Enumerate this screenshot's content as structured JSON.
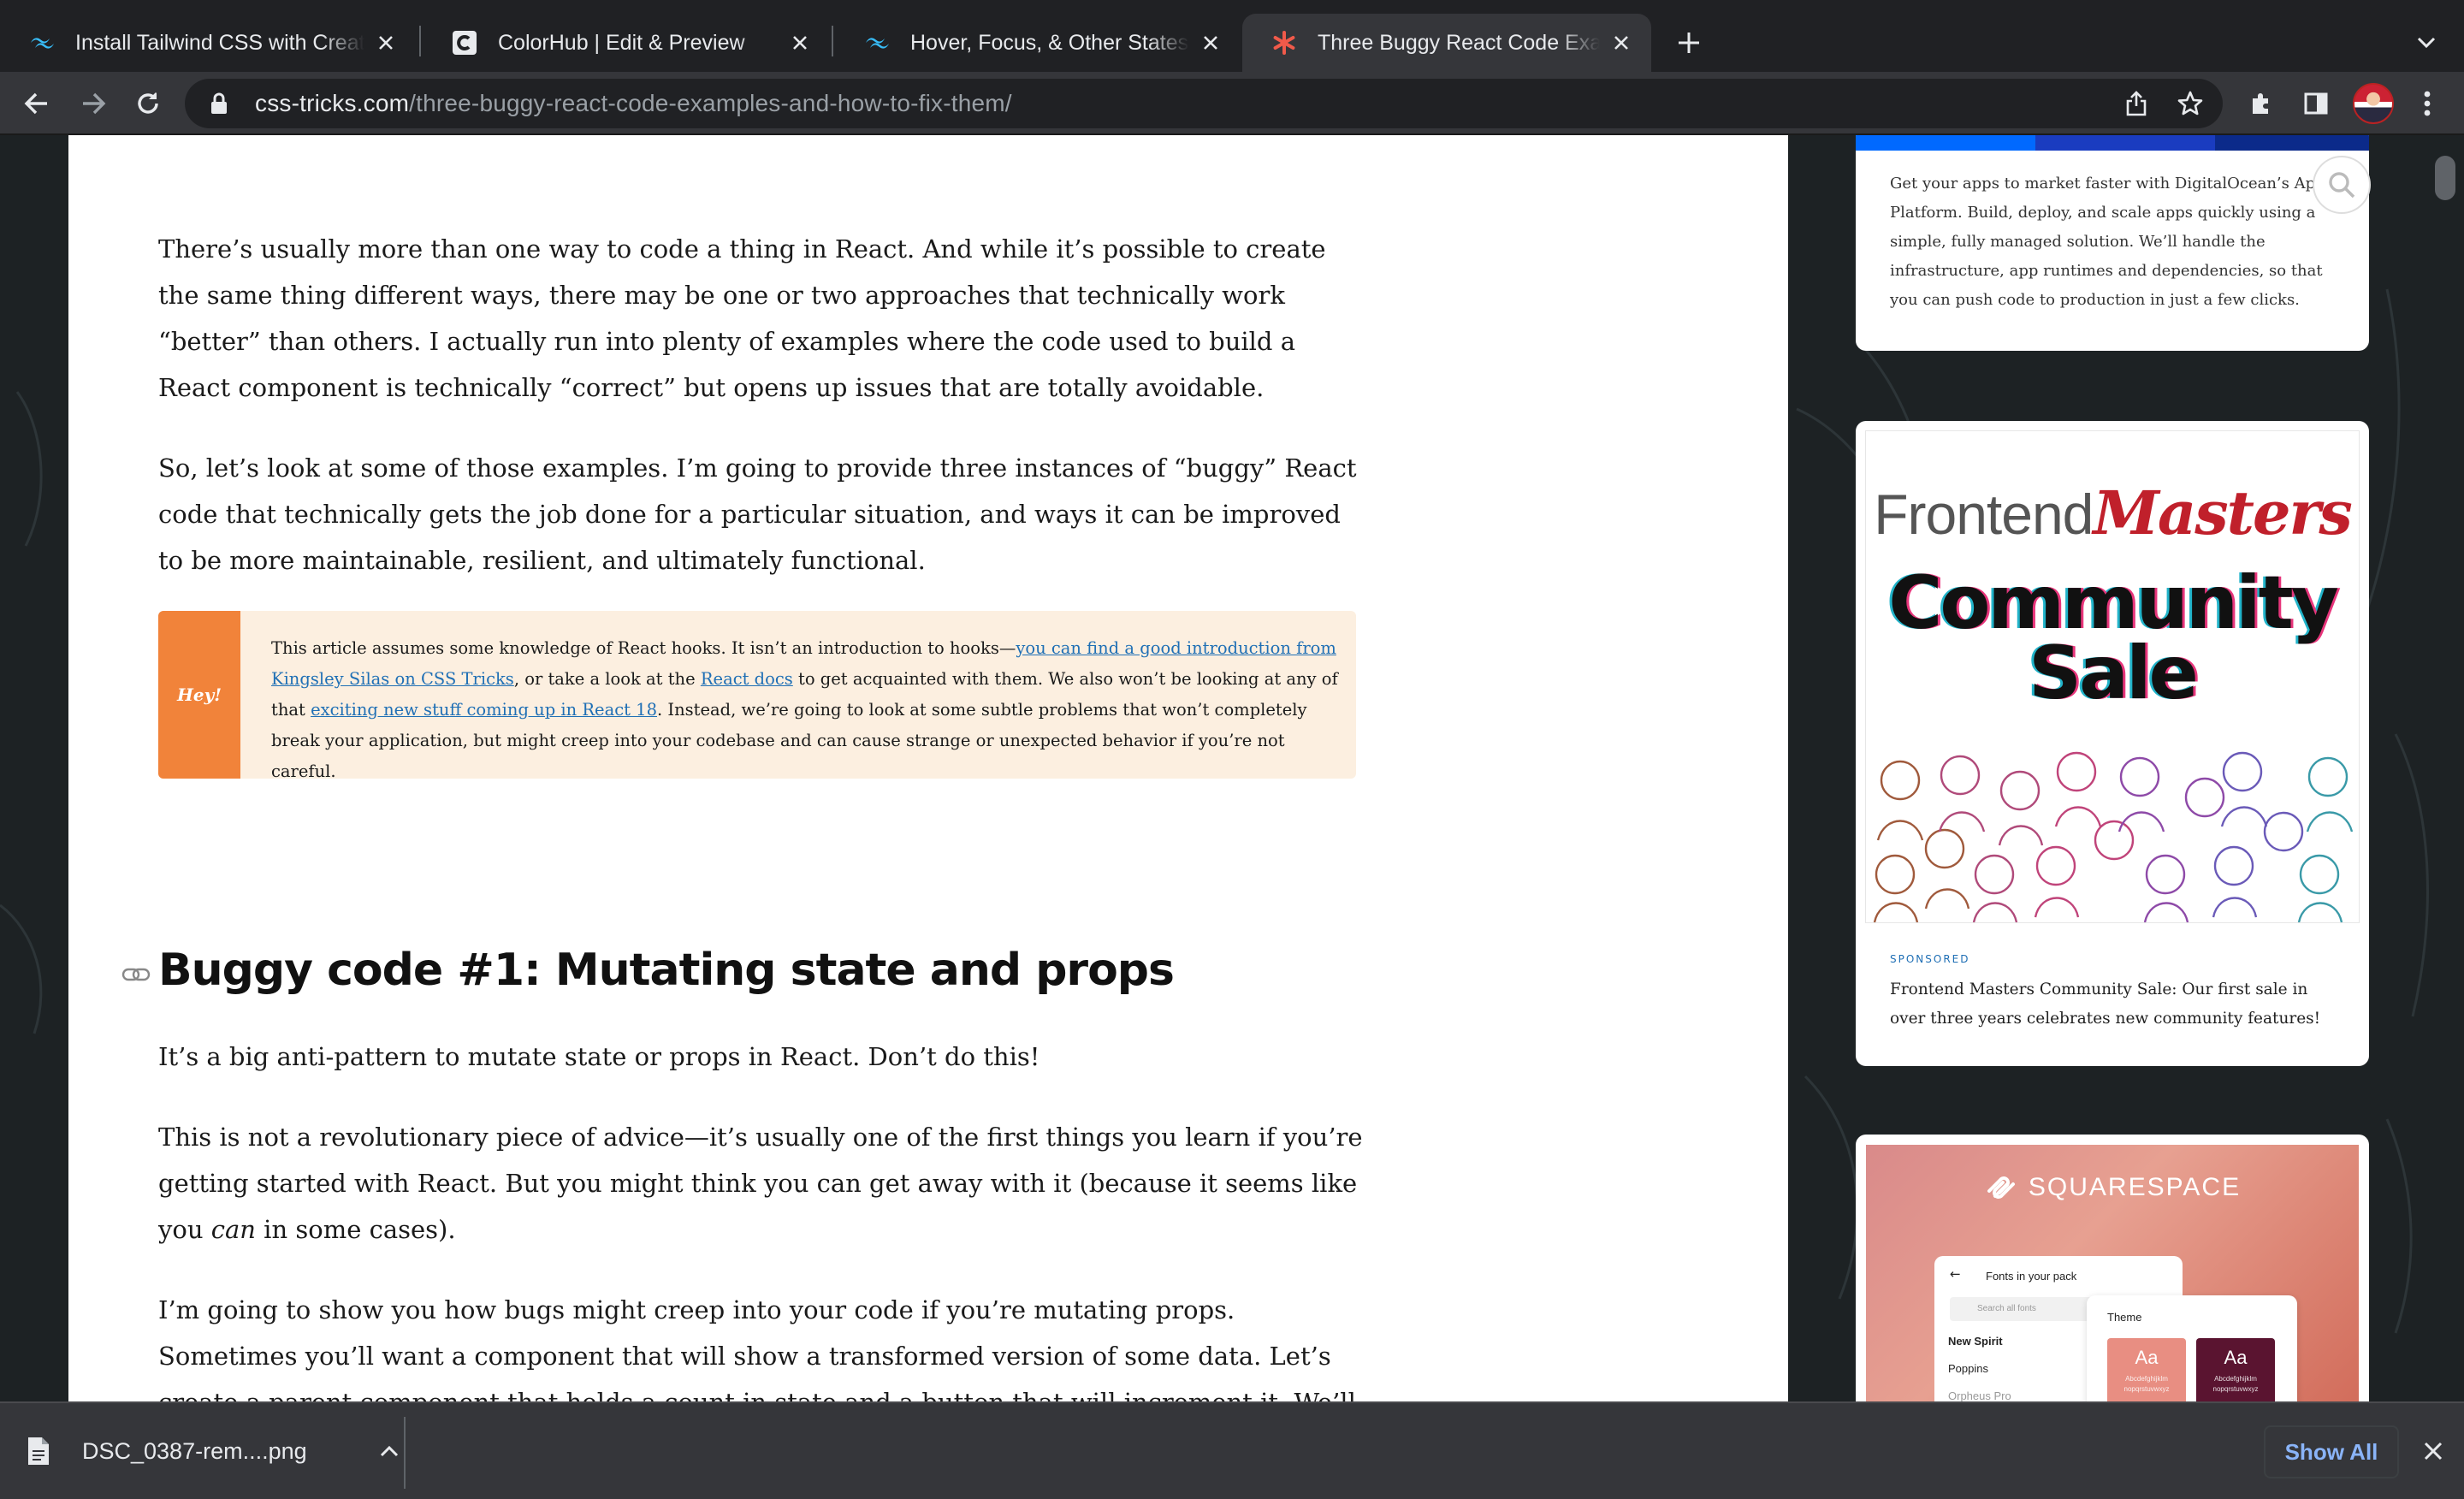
{
  "browser": {
    "tabs": [
      {
        "title": "Install Tailwind CSS with Create React App",
        "favicon": "tailwind-icon"
      },
      {
        "title": "ColorHub | Edit & Preview",
        "favicon": "colorhub-icon"
      },
      {
        "title": "Hover, Focus, & Other States - Tailwind CSS",
        "favicon": "tailwind-icon"
      },
      {
        "title": "Three Buggy React Code Examples",
        "favicon": "css-tricks-star-icon"
      }
    ],
    "active_tab": 3,
    "url_host": "css-tricks.com",
    "url_path": "/three-buggy-react-code-examples-and-how-to-fix-them/"
  },
  "article": {
    "p1": "There’s usually more than one way to code a thing in React. And while it’s possible to create the same thing different ways, there may be one or two approaches that technically work “better” than others. I actually run into plenty of examples where the code used to build a React component is technically “correct” but opens up issues that are totally avoidable.",
    "p2": "So, let’s look at some of those examples. I’m going to provide three instances of “buggy” React code that technically gets the job done for a particular situation, and ways it can be improved to be more maintainable, resilient, and ultimately functional.",
    "callout": {
      "tag": "Hey!",
      "t1": "This article assumes some knowledge of React hooks. It isn’t an introduction to hooks—",
      "link1": "you can find a good introduction from Kingsley Silas on CSS Tricks",
      "t2": ", or take a look at the ",
      "link2": "React docs",
      "t3": " to get acquainted with them. We also won’t be looking at any of that ",
      "link3": "exciting new stuff coming up in React 18",
      "t4": ". Instead, we’re going to look at some subtle problems that won’t completely break your application, but might creep into your codebase and can cause strange or unexpected behavior if you’re not careful."
    },
    "heading": "Buggy code #1: Mutating state and props",
    "p3": "It’s a big anti-pattern to mutate state or props in React. Don’t do this!",
    "p4_a": "This is not a revolutionary piece of advice—it’s usually one of the first things you learn if you’re getting started with React. But you might think you can get away with it (because it seems like you ",
    "p4_em": "can",
    "p4_b": " in some cases).",
    "p5": "I’m going to show you how bugs might creep into your code if you’re mutating props. Sometimes you’ll want a component that will show a transformed version of some data. Let’s create a parent component that holds a count in state and a button that will increment it. We’ll also make a child component that"
  },
  "sidebar": {
    "do_text": "Get your apps to market faster with DigitalOcean’s App Platform. Build, deploy, and scale apps quickly using a simple, fully managed solution. We’ll handle the infrastructure, app runtimes and dependencies, so that you can push code to production in just a few clicks.",
    "fm": {
      "logo_a": "Frontend",
      "logo_b": "Masters",
      "headline_1": "Community",
      "headline_2": "Sale",
      "sponsored": "SPONSORED",
      "caption": "Frontend Masters Community Sale: Our first sale in over three years celebrates new community features!"
    },
    "sq": {
      "logo": "SQUARESPACE",
      "panel_title": "Fonts in your pack",
      "search_placeholder": "Search all fonts",
      "fonts": [
        "New Spirit",
        "Poppins",
        "Orpheus Pro"
      ],
      "theme_title": "Theme",
      "swatch": "Aa",
      "swatch_sample": "Abcdefghijklm nopqrstuvwxyz"
    }
  },
  "downloads": {
    "file_name": "DSC_0387-rem....png",
    "show_all": "Show All"
  },
  "colors": {
    "accent_link": "#1f6fb5",
    "callout_bg": "#fcefe0",
    "callout_tag": "#f1833a",
    "chrome_dark": "#202124"
  }
}
